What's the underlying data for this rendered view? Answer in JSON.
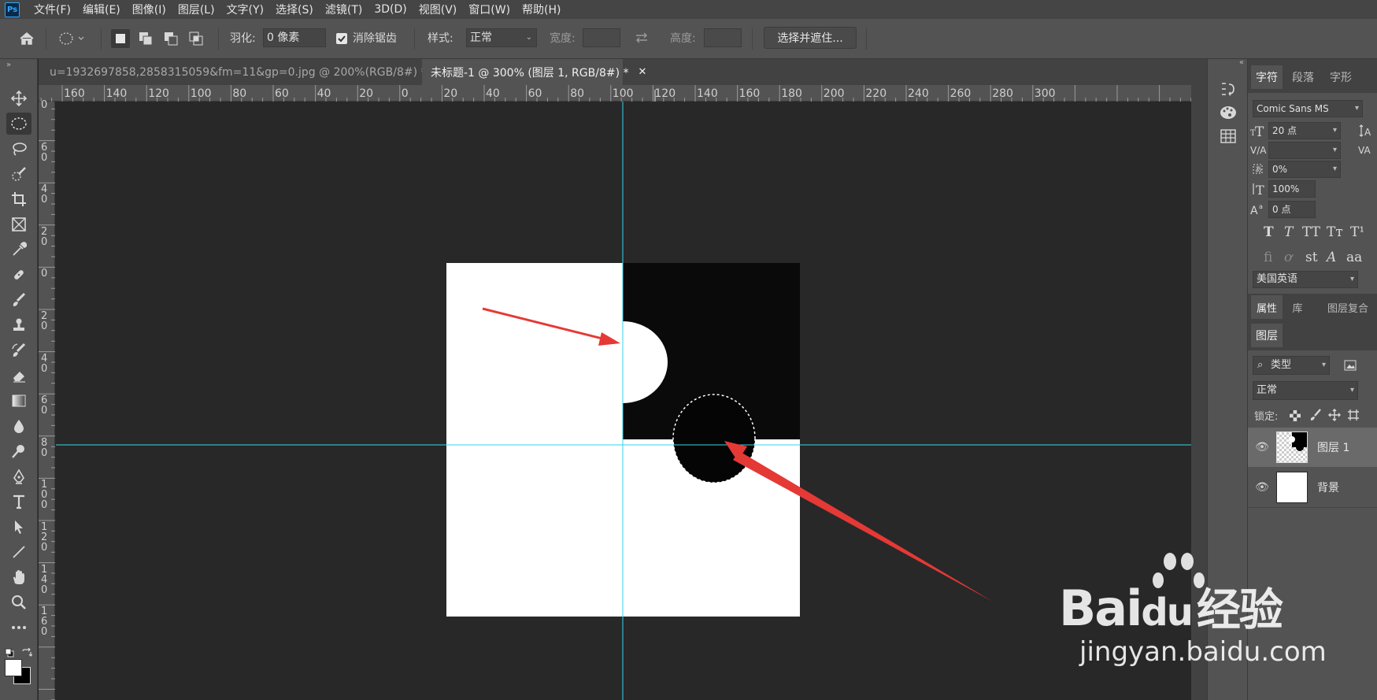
{
  "menu": [
    "文件(F)",
    "编辑(E)",
    "图像(I)",
    "图层(L)",
    "文字(Y)",
    "选择(S)",
    "滤镜(T)",
    "3D(D)",
    "视图(V)",
    "窗口(W)",
    "帮助(H)"
  ],
  "app_logo": "Ps",
  "options": {
    "feather_label": "羽化:",
    "feather_value": "0 像素",
    "antialias_label": "消除锯齿",
    "antialias_checked": true,
    "style_label": "样式:",
    "style_value": "正常",
    "width_label": "宽度:",
    "height_label": "高度:",
    "refine_button": "选择并遮住..."
  },
  "tabs": [
    {
      "label": "u=1932697858,2858315059&fm=11&gp=0.jpg @ 200%(RGB/8#) *",
      "active": false
    },
    {
      "label": "未标题-1 @ 300% (图层 1, RGB/8#) *",
      "active": true
    }
  ],
  "ruler_h_labels": [
    "160",
    "140",
    "120",
    "100",
    "80",
    "60",
    "40",
    "20",
    "0",
    "20",
    "40",
    "60",
    "80",
    "100",
    "120",
    "140",
    "160",
    "180",
    "200",
    "220",
    "240",
    "260",
    "280",
    "300"
  ],
  "ruler_v_labels": [
    "0",
    "60",
    "40",
    "20",
    "0",
    "20",
    "40",
    "60",
    "80",
    "100",
    "120",
    "140",
    "160"
  ],
  "character_panel": {
    "tabs": [
      "字符",
      "段落",
      "字形"
    ],
    "font_family": "Comic Sans MS",
    "font_size": "20 点",
    "tracking": "0%",
    "vertical_scale": "100%",
    "baseline_shift": "0 点",
    "language": "美国英语"
  },
  "properties_tabs": [
    "属性",
    "库",
    "图层复合"
  ],
  "layers_panel": {
    "title": "图层",
    "filter_label": "类型",
    "blend_mode": "正常",
    "lock_label": "锁定:",
    "layers": [
      {
        "name": "图层 1",
        "selected": true
      },
      {
        "name": "背景",
        "selected": false
      }
    ]
  },
  "watermark": {
    "brand": "Bai",
    "brand2": "du",
    "suffix": "经验",
    "url": "jingyan.baidu.com"
  }
}
